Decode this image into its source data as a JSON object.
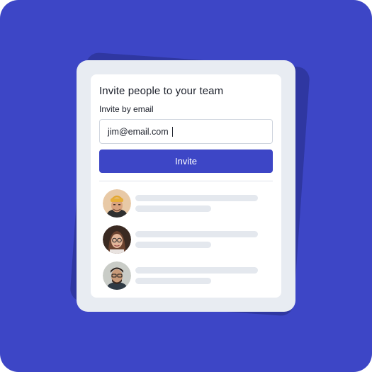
{
  "dialog": {
    "title": "Invite people to your team",
    "email_label": "Invite by email",
    "email_value": "jim@email.com",
    "invite_button": "Invite"
  },
  "members": [
    {
      "avatar": "avatar-man-yellow-beanie"
    },
    {
      "avatar": "avatar-woman-glasses"
    },
    {
      "avatar": "avatar-man-glasses-beard"
    }
  ],
  "colors": {
    "accent": "#3d46c6",
    "skeleton": "#e4e8ee"
  }
}
